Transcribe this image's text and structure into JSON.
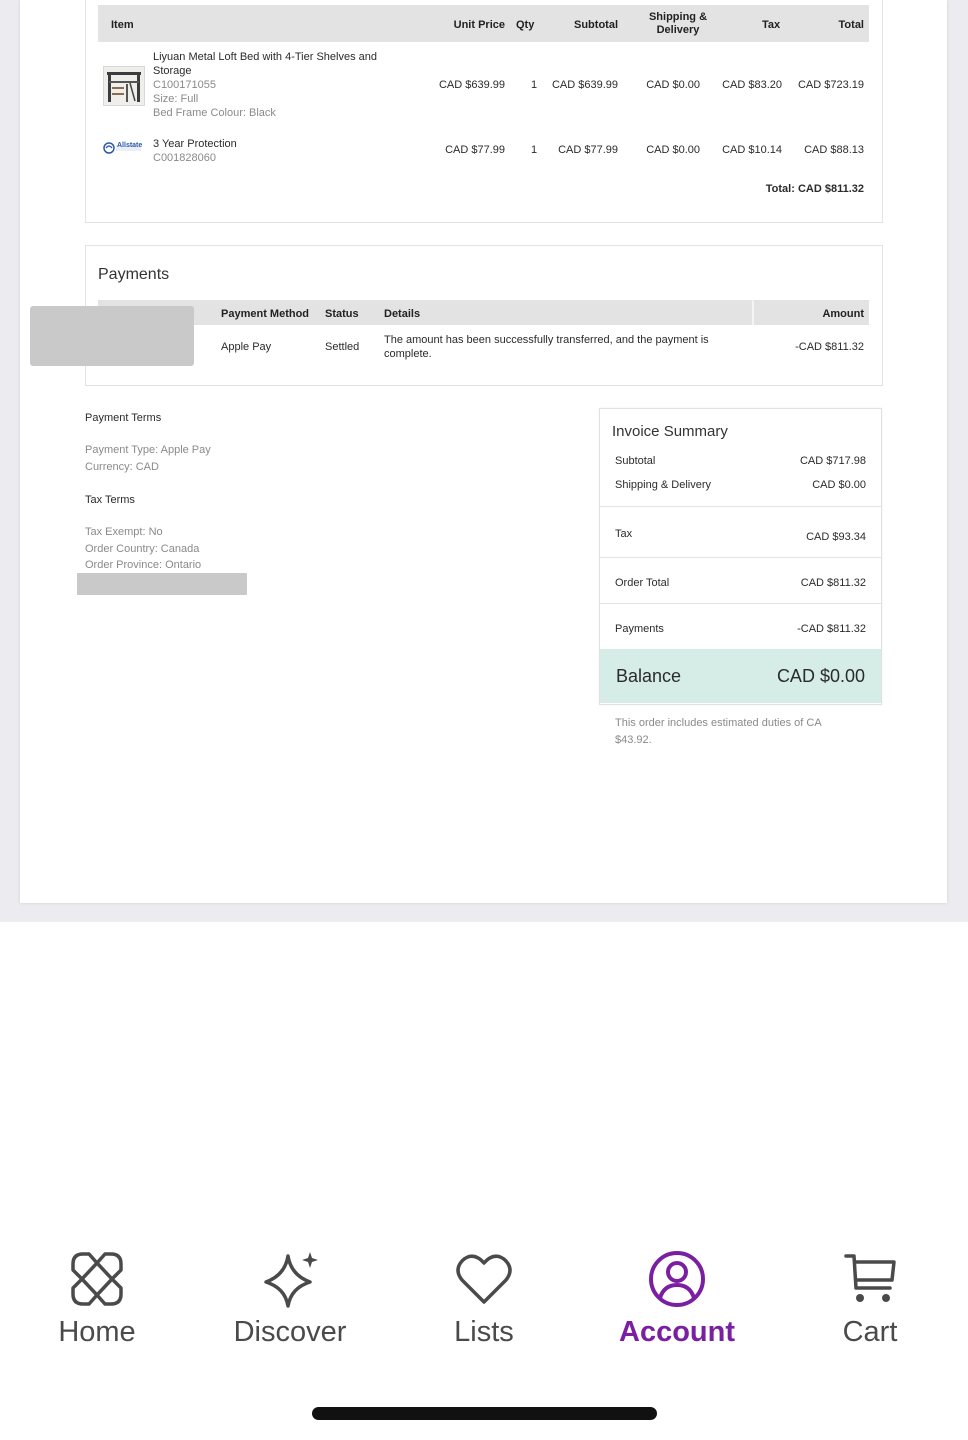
{
  "colors": {
    "accent": "#7b1fa2",
    "balance_bg": "#d5ede6",
    "table_header": "#e3e3e3"
  },
  "items_table": {
    "headers": {
      "item": "Item",
      "unit_price": "Unit Price",
      "qty": "Qty",
      "subtotal": "Subtotal",
      "shipping_line1": "Shipping &",
      "shipping_line2": "Delivery",
      "tax": "Tax",
      "total": "Total"
    },
    "rows": [
      {
        "name_line1": "Liyuan Metal Loft Bed with 4-Tier Shelves and",
        "name_line2": "Storage",
        "sku": "C100171055",
        "size": "Size: Full",
        "colour": "Bed Frame Colour: Black",
        "unit_price": "CAD $639.99",
        "qty": "1",
        "subtotal": "CAD $639.99",
        "shipping": "CAD $0.00",
        "tax": "CAD $83.20",
        "total": "CAD $723.19",
        "thumb_icon": "loft-bed-thumbnail"
      },
      {
        "name_line1": "3 Year Protection",
        "sku": "C001828060",
        "unit_price": "CAD $77.99",
        "qty": "1",
        "subtotal": "CAD $77.99",
        "shipping": "CAD $0.00",
        "tax": "CAD $10.14",
        "total": "CAD $88.13",
        "thumb_icon": "allstate-logo",
        "logo_text": "Allstate"
      }
    ],
    "grand_total": "Total: CAD $811.32"
  },
  "payments": {
    "title": "Payments",
    "headers": {
      "method": "Payment Method",
      "status": "Status",
      "details": "Details",
      "amount": "Amount"
    },
    "row": {
      "method": "Apple Pay",
      "status": "Settled",
      "details_line1": "The amount has been successfully transferred, and the payment is",
      "details_line2": "complete.",
      "amount": "-CAD $811.32"
    }
  },
  "terms": {
    "payment_terms_title": "Payment Terms",
    "payment_type": "Payment Type: Apple Pay",
    "currency": "Currency: CAD",
    "tax_terms_title": "Tax Terms",
    "tax_exempt": "Tax Exempt: No",
    "order_country": "Order Country: Canada",
    "order_province": "Order Province: Ontario"
  },
  "invoice_summary": {
    "title": "Invoice Summary",
    "subtotal_label": "Subtotal",
    "subtotal_value": "CAD $717.98",
    "shipping_label": "Shipping & Delivery",
    "shipping_value": "CAD $0.00",
    "tax_label": "Tax",
    "tax_value": "CAD $93.34",
    "order_total_label": "Order Total",
    "order_total_value": "CAD $811.32",
    "payments_label": "Payments",
    "payments_value": "-CAD $811.32",
    "balance_label": "Balance",
    "balance_value": "CAD $0.00",
    "duties_note_line1": "This order includes estimated duties of CA",
    "duties_note_line2": "$43.92."
  },
  "nav": {
    "items": [
      {
        "label": "Home",
        "icon": "home-icon"
      },
      {
        "label": "Discover",
        "icon": "sparkle-icon"
      },
      {
        "label": "Lists",
        "icon": "heart-icon"
      },
      {
        "label": "Account",
        "icon": "account-icon",
        "active": true
      },
      {
        "label": "Cart",
        "icon": "cart-icon"
      }
    ]
  }
}
